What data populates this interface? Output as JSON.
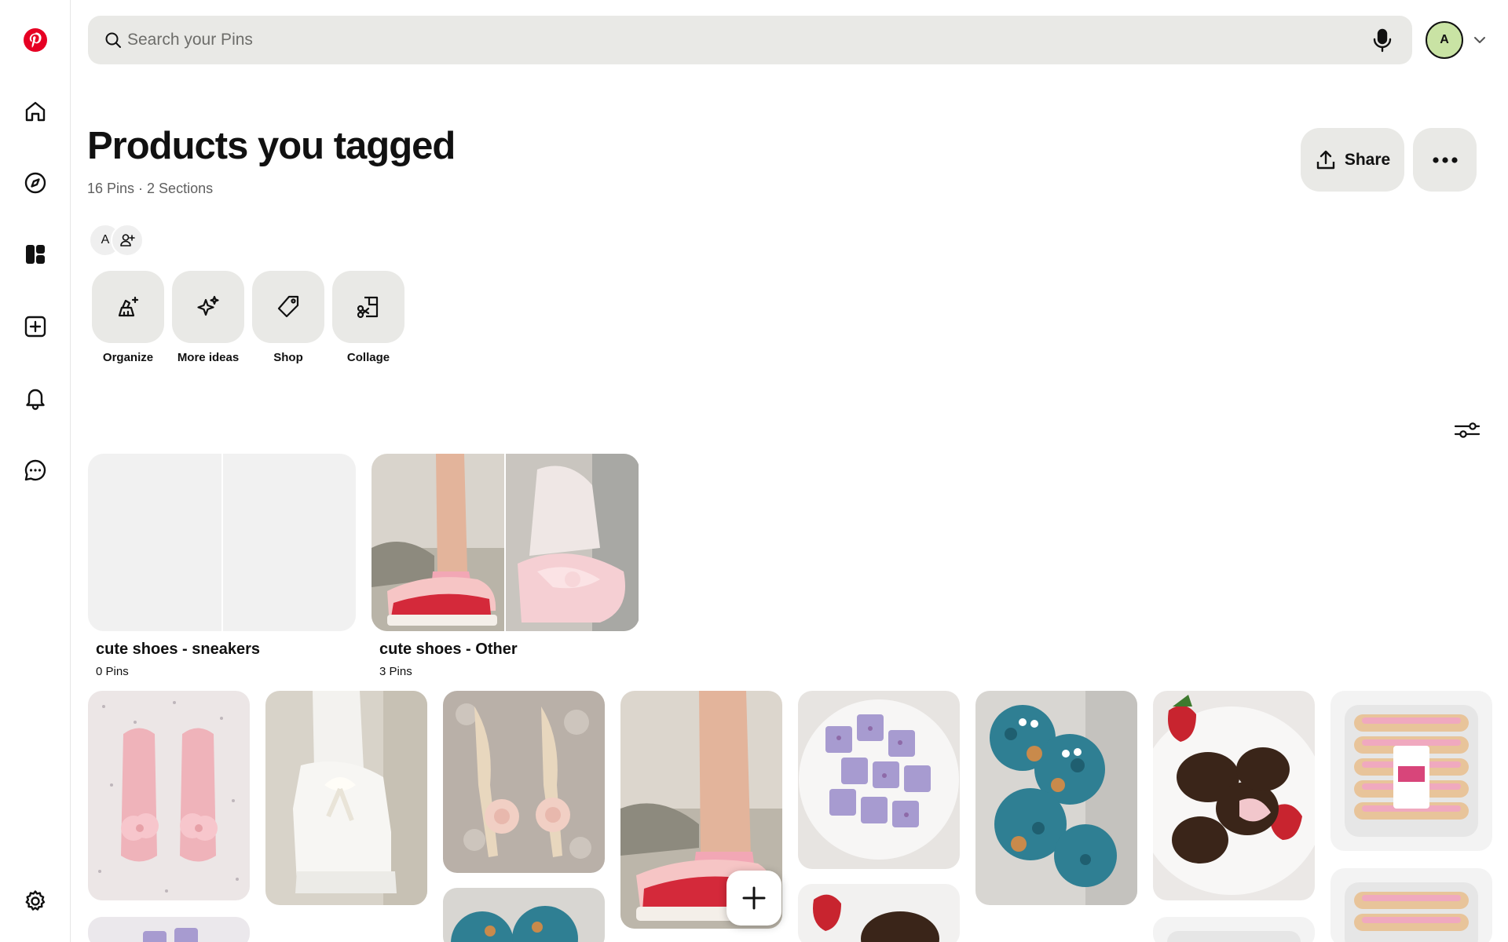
{
  "search": {
    "placeholder": "Search your Pins"
  },
  "account": {
    "initial": "A"
  },
  "header": {
    "title": "Products you tagged",
    "meta": "16 Pins · 2 Sections",
    "share_label": "Share"
  },
  "collaborators": {
    "owner_initial": "A"
  },
  "tools": [
    {
      "label": "Organize"
    },
    {
      "label": "More ideas"
    },
    {
      "label": "Shop"
    },
    {
      "label": "Collage"
    }
  ],
  "sections": [
    {
      "name": "cute shoes - sneakers",
      "count": "0 Pins"
    },
    {
      "name": "cute shoes - Other",
      "count": "3 Pins"
    }
  ],
  "pins": [
    {
      "subject": "pink flower sandals"
    },
    {
      "subject": "white platform heels with bow"
    },
    {
      "subject": "floral pointed heels"
    },
    {
      "subject": "pink and red sneakers"
    },
    {
      "subject": "purple marshmallows"
    },
    {
      "subject": "blue monster cookies"
    },
    {
      "subject": "chocolate covered strawberries"
    },
    {
      "subject": "frosted sugar cookies package"
    }
  ],
  "colors": {
    "brand": "#e60023",
    "surface": "#e9e9e6",
    "avatar": "#c9e3a4"
  }
}
